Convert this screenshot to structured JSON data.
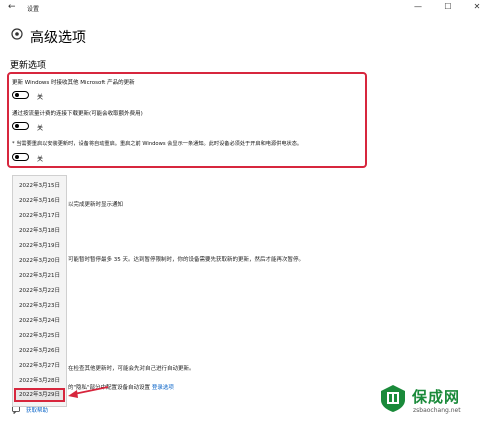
{
  "window": {
    "title": "设置",
    "back_glyph": "←",
    "minimize_glyph": "—",
    "maximize_glyph": "☐",
    "close_glyph": "✕"
  },
  "page": {
    "title": "高级选项"
  },
  "updates": {
    "heading": "更新选项",
    "option1": {
      "label": "更新 Windows 时接收其他 Microsoft 产品的更新",
      "state": "关"
    },
    "option2": {
      "label": "通过按流量计费的连接下载更新(可能会收取额外费用)",
      "state": "关"
    },
    "note": "* 当需要重启以安装更新时，设备将自动重启。重启之前 Windows 会显示一条通知。此时设备必须处于开启和电源供电状态。",
    "option3": {
      "state": "关"
    }
  },
  "background": {
    "notify_text": "以完成更新时显示通知",
    "pause_text": "可能暂时暂停最多 35 天。达到暂停限制时，你的设备需要先获取新的更新，然后才能再次暂停。",
    "check_text": "在检查其他更新时，可能会先对自己进行自动更新。",
    "privacy_prefix": "的\"隐私\"部分中配置设备自动设置",
    "privacy_link": "登录选项",
    "help_link": "获取帮助"
  },
  "date_dropdown": {
    "items": [
      "2022年3月15日",
      "2022年3月16日",
      "2022年3月17日",
      "2022年3月18日",
      "2022年3月19日",
      "2022年3月20日",
      "2022年3月21日",
      "2022年3月22日",
      "2022年3月23日",
      "2022年3月24日",
      "2022年3月25日",
      "2022年3月26日",
      "2022年3月27日",
      "2022年3月28日",
      "2022年3月29日"
    ],
    "selected": "2022年3月29日"
  },
  "watermark": {
    "text": "保成网",
    "subtext": "zsbaochang.net"
  },
  "colors": {
    "highlight": "#d7263d",
    "link": "#0a64c8",
    "watermark": "#1a8a3a"
  }
}
